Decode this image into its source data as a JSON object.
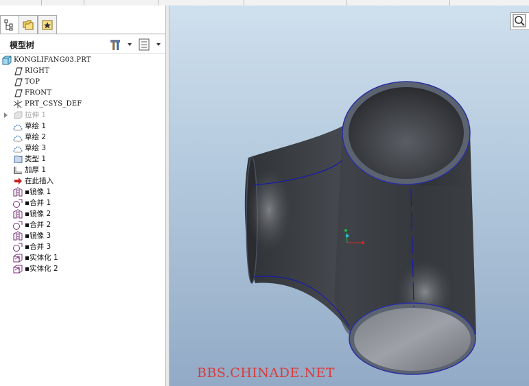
{
  "model_tree": {
    "title": "模型树",
    "items": [
      {
        "label": "KONGLIFANG03.PRT",
        "icon": "part-icon",
        "mono": true
      },
      {
        "label": "RIGHT",
        "icon": "datum-plane-icon",
        "mono": true
      },
      {
        "label": "TOP",
        "icon": "datum-plane-icon",
        "mono": true
      },
      {
        "label": "FRONT",
        "icon": "datum-plane-icon",
        "mono": true
      },
      {
        "label": "PRT_CSYS_DEF",
        "icon": "coordinate-system-icon",
        "mono": true
      },
      {
        "label": "拉伸 1",
        "icon": "extrude-icon",
        "dim": true,
        "expand": true
      },
      {
        "label": "草绘 1",
        "icon": "sketch-icon"
      },
      {
        "label": "草绘 2",
        "icon": "sketch-icon"
      },
      {
        "label": "草绘 3",
        "icon": "sketch-icon"
      },
      {
        "label": "类型 1",
        "icon": "boundary-blend-icon"
      },
      {
        "label": "加厚 1",
        "icon": "thicken-icon"
      },
      {
        "label": "在此插入",
        "icon": "insert-here-arrow-icon"
      },
      {
        "label": "▪镜像 1",
        "icon": "mirror-icon"
      },
      {
        "label": "▪合并 1",
        "icon": "merge-icon"
      },
      {
        "label": "▪镜像 2",
        "icon": "mirror-icon"
      },
      {
        "label": "▪合并 2",
        "icon": "merge-icon"
      },
      {
        "label": "▪镜像 3",
        "icon": "mirror-icon"
      },
      {
        "label": "▪合并 3",
        "icon": "merge-icon"
      },
      {
        "label": "▪实体化 1",
        "icon": "solidify-icon"
      },
      {
        "label": "▪实体化 2",
        "icon": "solidify-icon"
      }
    ]
  },
  "viewport": {
    "watermark": "BBS.CHINADE.NET"
  },
  "colors": {
    "viewport_top": "#cfe0ee",
    "viewport_bottom": "#92aac6",
    "model_body": "#3d4045",
    "edge_highlight": "#1a1aa8",
    "watermark": "#d93b3b"
  }
}
